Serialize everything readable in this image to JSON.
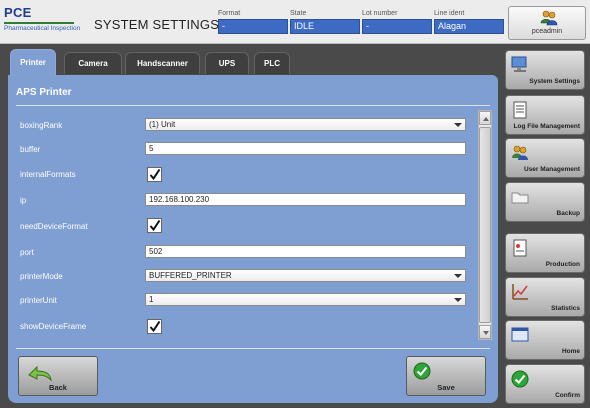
{
  "header": {
    "logo_brand": "PCE",
    "logo_sub": "Pharmaceutical Inspection",
    "title": "SYSTEM SETTINGS",
    "status": [
      {
        "label": "Format",
        "value": "-"
      },
      {
        "label": "State",
        "value": "IDLE"
      },
      {
        "label": "Lot number",
        "value": "-"
      },
      {
        "label": "Line ident",
        "value": "Alagan"
      }
    ],
    "user": "pceadmin"
  },
  "tabs": [
    {
      "label": "Printer",
      "active": true
    },
    {
      "label": "Camera"
    },
    {
      "label": "Handscanner"
    },
    {
      "label": "UPS"
    },
    {
      "label": "PLC"
    }
  ],
  "panel": {
    "title": "APS Printer",
    "rows": [
      {
        "label": "boxingRank",
        "type": "select",
        "value": "(1) Unit"
      },
      {
        "label": "buffer",
        "type": "text",
        "value": "5"
      },
      {
        "label": "internalFormats",
        "type": "checkbox",
        "checked": true
      },
      {
        "label": "ip",
        "type": "text",
        "value": "192.168.100.230"
      },
      {
        "label": "needDeviceFormat",
        "type": "checkbox",
        "checked": true
      },
      {
        "label": "port",
        "type": "text",
        "value": "502"
      },
      {
        "label": "printerMode",
        "type": "select",
        "value": "BUFFERED_PRINTER"
      },
      {
        "label": "printerUnit",
        "type": "select",
        "value": "1"
      },
      {
        "label": "showDeviceFrame",
        "type": "checkbox",
        "checked": true
      }
    ],
    "back_label": "Back",
    "save_label": "Save"
  },
  "sidebar": [
    {
      "label": "System Settings",
      "icon": "computer-icon"
    },
    {
      "label": "Log File Management",
      "icon": "document-icon"
    },
    {
      "label": "User Management",
      "icon": "users-icon"
    },
    {
      "label": "Backup",
      "icon": "folder-icon"
    },
    {
      "label": "Production",
      "icon": "production-icon"
    },
    {
      "label": "Statistics",
      "icon": "chart-icon"
    },
    {
      "label": "Home",
      "icon": "home-icon"
    },
    {
      "label": "Confirm",
      "icon": "check-icon"
    }
  ],
  "colors": {
    "panel": "#7f9ed2",
    "status_field": "#3d6bc4",
    "brand": "#1f3d8a"
  }
}
